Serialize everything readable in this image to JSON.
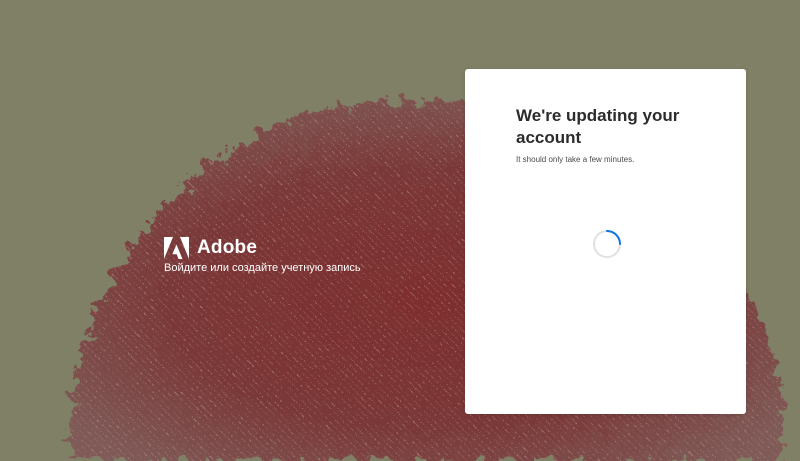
{
  "background": {
    "color": "#808066",
    "image": "red-fluffy-texture"
  },
  "brand": {
    "logo_icon": "adobe-logo-icon",
    "name": "Adobe",
    "tagline": "Войдите или создайте учетную запись"
  },
  "card": {
    "title": "We're updating your account",
    "subtitle": "It should only take a few minutes.",
    "loading_icon": "spinner-icon"
  },
  "colors": {
    "accent": "#1473e6",
    "spinner_track": "#e1e1e1",
    "card_bg": "#ffffff",
    "title_text": "#2c2c2c"
  }
}
